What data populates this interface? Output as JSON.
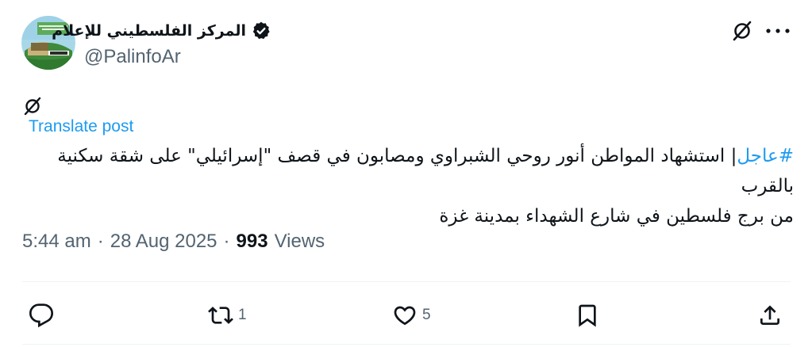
{
  "author": {
    "name": "المركز الفلسطيني للإعلام",
    "handle": "@PalinfoAr",
    "verified": true
  },
  "post": {
    "hashtag": "#عاجل",
    "text_line1": "| استشهاد المواطن أنور روحي الشبراوي ومصابون في قصف \"إسرائيلي\" على شقة سكنية بالقرب",
    "text_line2": "من برج فلسطين في شارع الشهداء بمدينة غزة",
    "translate_label": "Translate post"
  },
  "meta": {
    "time": "5:44 am",
    "separator1": "·",
    "date": "28 Aug 2025",
    "separator2": "·",
    "views_count": "993",
    "views_label": "Views"
  },
  "actions": {
    "reply_count": "",
    "repost_count": "1",
    "like_count": "5"
  },
  "colors": {
    "link": "#1d9bf0",
    "secondary_text": "#536471",
    "primary_text": "#0f1419",
    "divider": "#eff3f4"
  },
  "icons": [
    "verified-badge-icon",
    "no-translation-icon",
    "more-icon",
    "reply-icon",
    "repost-icon",
    "like-icon",
    "bookmark-icon",
    "share-icon"
  ]
}
